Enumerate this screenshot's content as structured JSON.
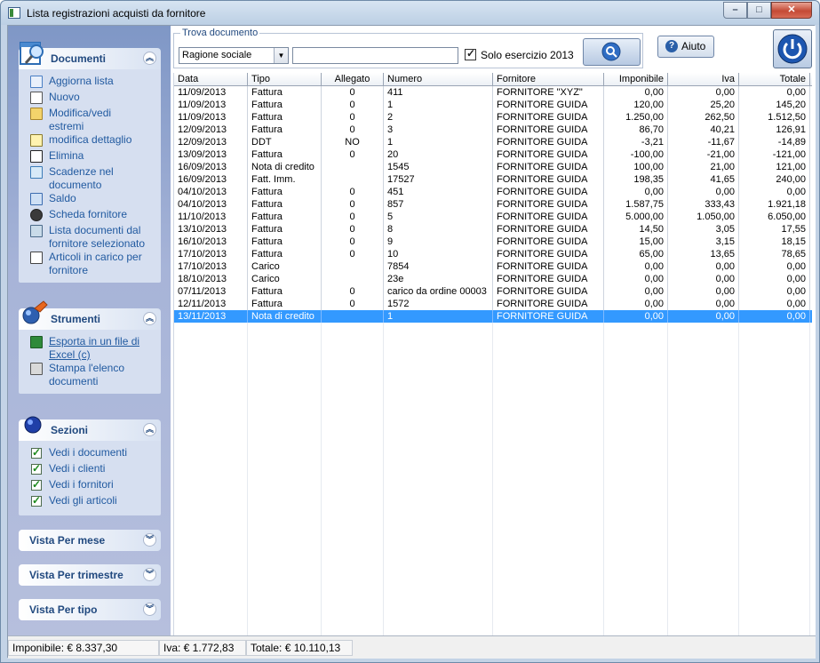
{
  "window": {
    "title": "Lista registrazioni acquisti da fornitore",
    "min_label": "–",
    "max_label": "□",
    "close_label": "✕"
  },
  "colors": {
    "accent": "#215aa0",
    "selection": "#3399ff"
  },
  "panels": {
    "documenti": {
      "title": "Documenti",
      "items": [
        "Aggiorna lista",
        "Nuovo",
        "Modifica/vedi\nestremi",
        "modifica dettaglio",
        "Elimina",
        "Scadenze nel\ndocumento",
        "Saldo",
        "Scheda fornitore",
        "Lista documenti dal\nfornitore selezionato",
        "Articoli in carico per\nfornitore"
      ]
    },
    "strumenti": {
      "title": "Strumenti",
      "items": [
        "Esporta in un file di\nExcel (c)",
        "Stampa l'elenco\ndocumenti"
      ]
    },
    "sezioni": {
      "title": "Sezioni",
      "items": [
        "Vedi i documenti",
        "Vedi i clienti",
        "Vedi i fornitori",
        "Vedi gli articoli"
      ]
    },
    "vista_mese": {
      "title": "Vista Per mese"
    },
    "vista_trimestre": {
      "title": "Vista Per trimestre"
    },
    "vista_tipo": {
      "title": "Vista Per tipo"
    }
  },
  "search": {
    "legend": "Trova documento",
    "field_value": "Ragione sociale",
    "query_value": "",
    "checkbox_label": "Solo esercizio 2013",
    "checkbox_checked": true
  },
  "toolbar": {
    "help_label": "Aiuto"
  },
  "table": {
    "columns": [
      "Data",
      "Tipo",
      "Allegato",
      "Numero",
      "Fornitore",
      "Imponibile",
      "Iva",
      "Totale"
    ],
    "rows": [
      [
        "11/09/2013",
        "Fattura",
        "0",
        "411",
        "FORNITORE \"XYZ\"",
        "0,00",
        "0,00",
        "0,00"
      ],
      [
        "11/09/2013",
        "Fattura",
        "0",
        "1",
        "FORNITORE GUIDA",
        "120,00",
        "25,20",
        "145,20"
      ],
      [
        "11/09/2013",
        "Fattura",
        "0",
        "2",
        "FORNITORE GUIDA",
        "1.250,00",
        "262,50",
        "1.512,50"
      ],
      [
        "12/09/2013",
        "Fattura",
        "0",
        "3",
        "FORNITORE GUIDA",
        "86,70",
        "40,21",
        "126,91"
      ],
      [
        "12/09/2013",
        "DDT",
        "NO",
        "1",
        "FORNITORE GUIDA",
        "-3,21",
        "-11,67",
        "-14,89"
      ],
      [
        "13/09/2013",
        "Fattura",
        "0",
        "20",
        "FORNITORE GUIDA",
        "-100,00",
        "-21,00",
        "-121,00"
      ],
      [
        "16/09/2013",
        "Nota di credito",
        "",
        "1545",
        "FORNITORE GUIDA",
        "100,00",
        "21,00",
        "121,00"
      ],
      [
        "16/09/2013",
        "Fatt. Imm.",
        "",
        "17527",
        "FORNITORE GUIDA",
        "198,35",
        "41,65",
        "240,00"
      ],
      [
        "04/10/2013",
        "Fattura",
        "0",
        "451",
        "FORNITORE GUIDA",
        "0,00",
        "0,00",
        "0,00"
      ],
      [
        "04/10/2013",
        "Fattura",
        "0",
        "857",
        "FORNITORE GUIDA",
        "1.587,75",
        "333,43",
        "1.921,18"
      ],
      [
        "11/10/2013",
        "Fattura",
        "0",
        "5",
        "FORNITORE GUIDA",
        "5.000,00",
        "1.050,00",
        "6.050,00"
      ],
      [
        "13/10/2013",
        "Fattura",
        "0",
        "8",
        "FORNITORE GUIDA",
        "14,50",
        "3,05",
        "17,55"
      ],
      [
        "16/10/2013",
        "Fattura",
        "0",
        "9",
        "FORNITORE GUIDA",
        "15,00",
        "3,15",
        "18,15"
      ],
      [
        "17/10/2013",
        "Fattura",
        "0",
        "10",
        "FORNITORE GUIDA",
        "65,00",
        "13,65",
        "78,65"
      ],
      [
        "17/10/2013",
        "Carico",
        "",
        "7854",
        "FORNITORE GUIDA",
        "0,00",
        "0,00",
        "0,00"
      ],
      [
        "18/10/2013",
        "Carico",
        "",
        "23e",
        "FORNITORE GUIDA",
        "0,00",
        "0,00",
        "0,00"
      ],
      [
        "07/11/2013",
        "Fattura",
        "0",
        "carico da ordine 00003",
        "FORNITORE GUIDA",
        "0,00",
        "0,00",
        "0,00"
      ],
      [
        "12/11/2013",
        "Fattura",
        "0",
        "1572",
        "FORNITORE GUIDA",
        "0,00",
        "0,00",
        "0,00"
      ],
      [
        "13/11/2013",
        "Nota di credito",
        "",
        "1",
        "FORNITORE GUIDA",
        "0,00",
        "0,00",
        "0,00"
      ]
    ],
    "selected_row": 18
  },
  "status": {
    "imponibile": "Imponibile: € 8.337,30",
    "iva": "Iva: € 1.772,83",
    "totale": "Totale: € 10.110,13"
  }
}
